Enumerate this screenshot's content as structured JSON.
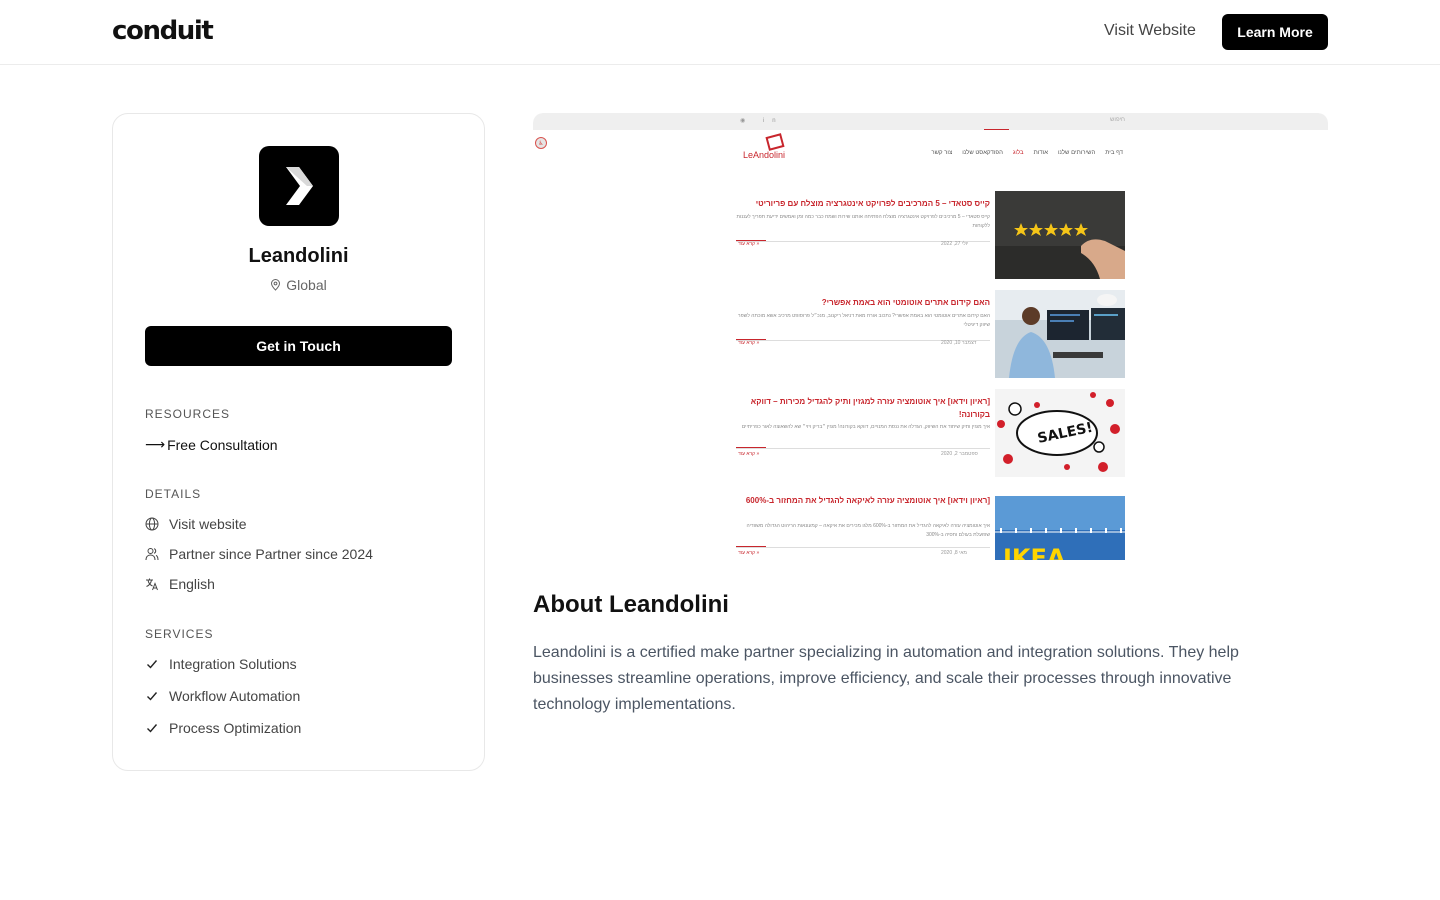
{
  "header": {
    "logo": "conduit",
    "visit_label": "Visit Website",
    "learn_label": "Learn More"
  },
  "profile": {
    "name": "Leandolini",
    "location": "Global",
    "cta_label": "Get in Touch"
  },
  "resources": {
    "title": "RESOURCES",
    "items": [
      {
        "label": "Free Consultation",
        "arrow": "⟶"
      }
    ]
  },
  "details": {
    "title": "DETAILS",
    "items": [
      {
        "icon": "globe-icon",
        "label": "Visit website"
      },
      {
        "icon": "users-icon",
        "label": "Partner since Partner since 2024"
      },
      {
        "icon": "translate-icon",
        "label": "English"
      }
    ]
  },
  "services": {
    "title": "SERVICES",
    "items": [
      {
        "icon": "check-icon",
        "label": "Integration Solutions"
      },
      {
        "icon": "check-icon",
        "label": "Workflow Automation"
      },
      {
        "icon": "check-icon",
        "label": "Process Optimization"
      }
    ]
  },
  "preview": {
    "logo_text": "LeAndolini",
    "topbar_text": "חיפוש",
    "nav": [
      "דף בית",
      "השירותים שלנו",
      "אודות",
      "בלוג",
      "הפודקאסט שלנו",
      "צור קשר"
    ],
    "posts": [
      {
        "title": "קייס סטאדי – 5 המרכיבים לפרויקט אינטגרציה מוצלח עם פריוריטי",
        "excerpt": "קייס סטאדי – 5 מרכיבים לפרויקט אינטגרציה מוצלח הפתיחה אותנו שירות ושמח כבר כמה זמן ואמשים ידיעת תפריך לעננות ללקוחות",
        "date": "יולי 27, 2022",
        "more": "קרא עוד »"
      },
      {
        "title": "האם קידום אתרים אוטומטי הוא באמת אפשרי?",
        "excerpt": "האם קידום אתרים אוטומטי הוא באמת אפשרי? נתכוב אורח מאת דניאל ריקנוב, מנכ״ל פרוסופט מרכיב אשא מוכתה לשפר שיווק דיגיטלי",
        "date": "דצמבר 10, 2020",
        "more": "קרא עוד »"
      },
      {
        "title": "[ראיון וידאו] איך אוטומציה עזרה למגזין ותיק להגדיל מכירות – דווקא בקורונה!",
        "excerpt": "איך מגזין ותיק שיחוד את השיווק, הגדלה את ננסת המנויים, דווקא בקורונה! מגזין ״בריק ויזי״ שא להשאוצה לאור כפריתיים",
        "date": "ספטמבר 2, 2020",
        "more": "קרא עוד »"
      },
      {
        "title": "[ראיון וידאו] איך אוטומציה עזרה לאיקאה להגדיל את המחזור ב-600%",
        "excerpt": "איך אוטומציה עזרה לאיקאה להגדיל את המחזור ב-600% מלגו מכירים את איקאה – קמעונאות הריהוט הגדולה משוודיה שפועלת בעולם וחסיה ב-300%",
        "date": "מאי 8, 2020",
        "more": "קרא עוד »"
      }
    ]
  },
  "about": {
    "title": "About Leandolini",
    "body": "Leandolini is a certified make partner specializing in automation and integration solutions. They help businesses streamline operations, improve efficiency, and scale their processes through innovative technology implementations."
  },
  "colors": {
    "accent": "#000000",
    "brand_red": "#c8262d",
    "text_muted": "#4b5563"
  }
}
